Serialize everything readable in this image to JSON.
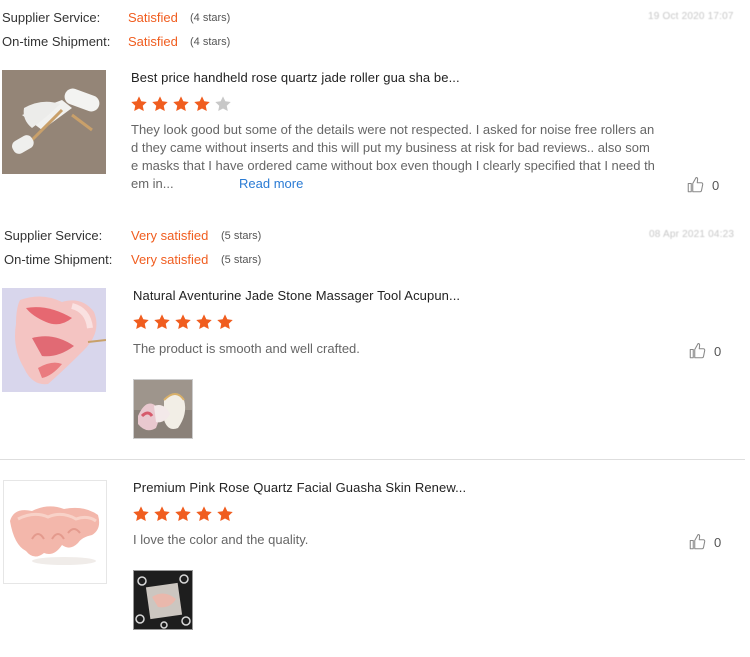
{
  "colors": {
    "accent": "#f05d1f",
    "link": "#2a7bd4",
    "star_empty": "#c8c8c8"
  },
  "reviews": [
    {
      "supplier_label": "Supplier Service:",
      "supplier_rating": "Satisfied",
      "supplier_stars": "(4 stars)",
      "shipment_label": "On-time Shipment:",
      "shipment_rating": "Satisfied",
      "shipment_stars": "(4 stars)",
      "date": "19 Oct 2020 17:07",
      "product_title": "Best price handheld rose quartz jade roller gua sha be...",
      "star_rating": 4,
      "text_lines": [
        "They look good but some of the details were not respected. I asked for noise free rollers an",
        "d they came without inserts and this will put my business at risk for bad reviews.. also som",
        "e masks that I have ordered came without box even though I clearly specified that I need th",
        "em in..."
      ],
      "read_more": "Read more",
      "likes": "0",
      "icon": "thumbs-up-icon"
    },
    {
      "supplier_label": "Supplier Service:",
      "supplier_rating": "Very satisfied",
      "supplier_stars": "(5 stars)",
      "shipment_label": "On-time Shipment:",
      "shipment_rating": "Very satisfied",
      "shipment_stars": "(5 stars)",
      "date": "08 Apr 2021 04:23",
      "product_title": "Natural Aventurine Jade Stone Massager Tool Acupun...",
      "star_rating": 5,
      "text": "The product is smooth and well crafted.",
      "likes": "0",
      "icon": "thumbs-up-icon"
    },
    {
      "product_title": "Premium Pink Rose Quartz Facial Guasha Skin Renew...",
      "star_rating": 5,
      "text": "I love the color and the quality.",
      "likes": "0",
      "icon": "thumbs-up-icon"
    }
  ]
}
